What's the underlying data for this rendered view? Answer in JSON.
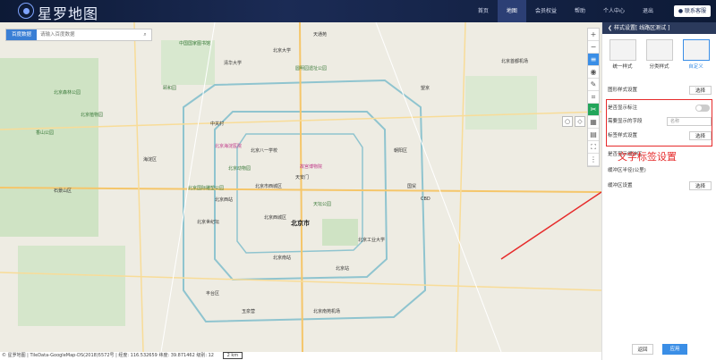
{
  "app": {
    "title": "星罗地图",
    "support_label": "联系客服"
  },
  "nav": [
    "首页",
    "地图",
    "会员权益",
    "帮助",
    "个人中心",
    "退出"
  ],
  "search": {
    "select_label": "百度数据",
    "placeholder": "请输入百度数据"
  },
  "map": {
    "center_label": "北京市",
    "labels": [
      "中国国家图书馆",
      "北京大学",
      "清华大学",
      "圆明园遗址公园",
      "颐和园",
      "中关村",
      "北京海淀医院",
      "北京动物园",
      "北京西站",
      "天安门",
      "故宫博物院",
      "北京南站",
      "天坛公园",
      "北京工业大学",
      "北京站",
      "北京南苑机场",
      "北京森林公园",
      "北京国际雕塑公园",
      "北京八一学校",
      "北京市西城区",
      "北京西城区",
      "丰台区",
      "朝阳区",
      "海淀区",
      "天通苑",
      "北京植物园",
      "香山公园",
      "石景山区",
      "北京世纪坛",
      "玉泉营",
      "北京首都机场",
      "望京",
      "国贸",
      "CBD"
    ]
  },
  "status": {
    "text": "© 星罗地图 | TileData-GoogleMap-DS(2018)5572号 | 经度: 116.532659  纬度: 39.871462  级别: 12",
    "scale": "2 km"
  },
  "panel": {
    "title": "样式设置[ 线路区测试 ]",
    "styles": [
      {
        "label": "统一样式"
      },
      {
        "label": "分类样式"
      },
      {
        "label": "自定义",
        "selected": true
      }
    ],
    "rows": [
      {
        "label": "图形样式设置",
        "control": "选择"
      },
      {
        "label": "是否显示标注",
        "control": ""
      },
      {
        "label": "需要显示的字段",
        "control": "名称"
      },
      {
        "label": "标签样式设置",
        "control": "选择"
      },
      {
        "label": "是否显示缓冲区",
        "control": ""
      },
      {
        "label": "缓冲区半径(公里)",
        "control": ""
      },
      {
        "label": "缓冲区设置",
        "control": "选择"
      }
    ],
    "back_label": "返回",
    "apply_label": "应用"
  },
  "annotation": "文字标签设置",
  "colors": {
    "topbar": "#1b2b55",
    "accent": "#3a8ee6",
    "highlight": "#e62a2a",
    "ring": "#7fb8c8"
  }
}
